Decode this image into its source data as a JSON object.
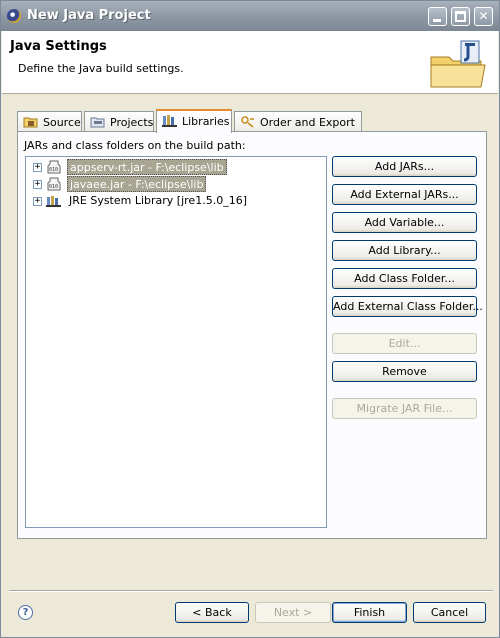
{
  "window": {
    "title": "New Java Project"
  },
  "header": {
    "title": "Java Settings",
    "description": "Define the Java build settings."
  },
  "tabs": [
    {
      "label": "Source",
      "icon": "source-folder-icon"
    },
    {
      "label": "Projects",
      "icon": "projects-icon"
    },
    {
      "label": "Libraries",
      "icon": "libraries-icon",
      "active": true
    },
    {
      "label": "Order and Export",
      "icon": "order-export-icon"
    }
  ],
  "libraries": {
    "label": "JARs and class folders on the build path:",
    "entries": [
      {
        "label": "appserv-rt.jar - F:\\eclipse\\lib",
        "icon": "jar-icon",
        "selected": true
      },
      {
        "label": "javaee.jar - F:\\eclipse\\lib",
        "icon": "jar-icon",
        "selected": true
      },
      {
        "label": "JRE System Library [jre1.5.0_16]",
        "icon": "library-icon",
        "selected": false
      }
    ],
    "buttons": {
      "add_jars": "Add JARs...",
      "add_external_jars": "Add External JARs...",
      "add_variable": "Add Variable...",
      "add_library": "Add Library...",
      "add_class_folder": "Add Class Folder...",
      "add_external_class_folder": "Add External Class Folder...",
      "edit": "Edit...",
      "remove": "Remove",
      "migrate_jar": "Migrate JAR File..."
    }
  },
  "footer": {
    "back": "< Back",
    "next": "Next >",
    "finish": "Finish",
    "cancel": "Cancel",
    "help_icon": "help-icon"
  },
  "colors": {
    "titlebar": "#8f99a5",
    "selection": "#a8a592",
    "active_tab_accent": "#e68b2c"
  }
}
